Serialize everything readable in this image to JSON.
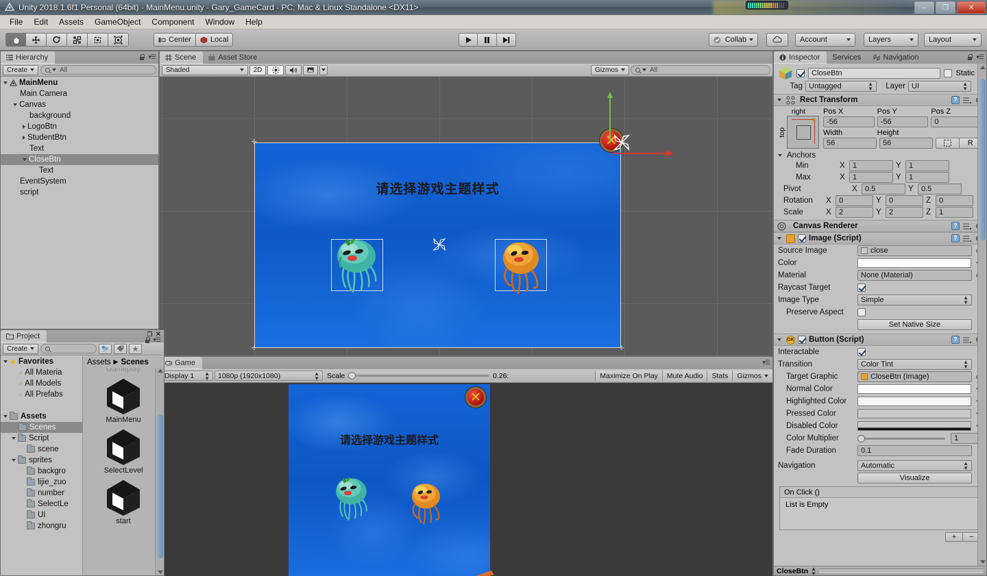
{
  "window": {
    "title": "Unity 2018.1.6f1 Personal (64bit) - MainMenu.unity - Gary_GameCard - PC, Mac & Linux Standalone <DX11>",
    "minimize": "–",
    "maximize": "❐",
    "close": "✕"
  },
  "menu": {
    "items": [
      "File",
      "Edit",
      "Assets",
      "GameObject",
      "Component",
      "Window",
      "Help"
    ]
  },
  "toolbar": {
    "transform_tools": [
      "hand-tool",
      "move-tool",
      "rotate-tool",
      "scale-tool",
      "rect-tool",
      "transform-tool"
    ],
    "pivot_mode": "Center",
    "pivot_rotation": "Local",
    "play": "▶",
    "pause": "▐▐",
    "step": "▶|",
    "collab": "Collab",
    "cloud": "cloud-icon",
    "account": "Account",
    "layers": "Layers",
    "layout": "Layout"
  },
  "hierarchy": {
    "tab": "Hierarchy",
    "create": "Create",
    "search_placeholder": "All",
    "items": [
      {
        "label": "MainMenu",
        "depth": 0,
        "arrow": "open",
        "bold": true,
        "selected": false,
        "icon": "unity"
      },
      {
        "label": "Main Camera",
        "depth": 1,
        "arrow": "none",
        "bold": false,
        "selected": false
      },
      {
        "label": "Canvas",
        "depth": 1,
        "arrow": "open",
        "bold": false,
        "selected": false
      },
      {
        "label": "background",
        "depth": 2,
        "arrow": "none",
        "bold": false,
        "selected": false
      },
      {
        "label": "LogoBtn",
        "depth": 2,
        "arrow": "closed",
        "bold": false,
        "selected": false
      },
      {
        "label": "StudentBtn",
        "depth": 2,
        "arrow": "closed",
        "bold": false,
        "selected": false
      },
      {
        "label": "Text",
        "depth": 2,
        "arrow": "none",
        "bold": false,
        "selected": false
      },
      {
        "label": "CloseBtn",
        "depth": 2,
        "arrow": "open",
        "bold": false,
        "selected": true
      },
      {
        "label": "Text",
        "depth": 3,
        "arrow": "none",
        "bold": false,
        "selected": false
      },
      {
        "label": "EventSystem",
        "depth": 1,
        "arrow": "none",
        "bold": false,
        "selected": false
      },
      {
        "label": "script",
        "depth": 1,
        "arrow": "none",
        "bold": false,
        "selected": false
      }
    ]
  },
  "scene": {
    "tabs": [
      {
        "label": "Scene",
        "active": true
      },
      {
        "label": "Asset Store",
        "active": false
      }
    ],
    "draw_mode": "Shaded",
    "two_d": "2D",
    "lighting": "light-icon",
    "audio": "audio-icon",
    "fx": "fx-icon",
    "gizmos": "Gizmos",
    "search_placeholder": "All",
    "content": {
      "heading": "请选择游戏主题样式",
      "close_glyph": "✕",
      "jellyfish": [
        {
          "name": "teal-jellyfish",
          "color": "#4fb5a6"
        },
        {
          "name": "orange-jellyfish",
          "color": "#e8962e"
        }
      ]
    }
  },
  "game": {
    "tab": "Game",
    "display": "Display 1",
    "resolution": "1080p (1920x1080)",
    "scale_label": "Scale",
    "scale_value": "0.26:",
    "maximize_on_play": "Maximize On Play",
    "mute_audio": "Mute Audio",
    "stats": "Stats",
    "gizmos": "Gizmos",
    "content": {
      "heading": "请选择游戏主题样式",
      "close_glyph": "✕"
    }
  },
  "project": {
    "tab": "Project",
    "create": "Create",
    "search_placeholder": "",
    "breadcrumb": [
      "Assets",
      "Scenes"
    ],
    "tree": [
      {
        "label": "Favorites",
        "depth": 0,
        "arrow": "open",
        "icon": "star",
        "bold": true,
        "selected": false
      },
      {
        "label": "All Materia",
        "depth": 1,
        "arrow": "none",
        "icon": "search",
        "bold": false,
        "selected": false
      },
      {
        "label": "All Models",
        "depth": 1,
        "arrow": "none",
        "icon": "search",
        "bold": false,
        "selected": false
      },
      {
        "label": "All Prefabs",
        "depth": 1,
        "arrow": "none",
        "icon": "search",
        "bold": false,
        "selected": false
      },
      {
        "label": "",
        "depth": 0,
        "arrow": "none",
        "icon": "none",
        "bold": false,
        "selected": false
      },
      {
        "label": "Assets",
        "depth": 0,
        "arrow": "open",
        "icon": "folder",
        "bold": true,
        "selected": false
      },
      {
        "label": "Scenes",
        "depth": 1,
        "arrow": "none",
        "icon": "folder",
        "bold": false,
        "selected": true
      },
      {
        "label": "Script",
        "depth": 1,
        "arrow": "open",
        "icon": "folder",
        "bold": false,
        "selected": false
      },
      {
        "label": "scene",
        "depth": 2,
        "arrow": "none",
        "icon": "folder",
        "bold": false,
        "selected": false
      },
      {
        "label": "sprites",
        "depth": 1,
        "arrow": "open",
        "icon": "folder",
        "bold": false,
        "selected": false
      },
      {
        "label": "backgro",
        "depth": 2,
        "arrow": "none",
        "icon": "folder",
        "bold": false,
        "selected": false
      },
      {
        "label": "lijie_zuo",
        "depth": 2,
        "arrow": "none",
        "icon": "folderb",
        "bold": false,
        "selected": false
      },
      {
        "label": "number",
        "depth": 2,
        "arrow": "none",
        "icon": "folder",
        "bold": false,
        "selected": false
      },
      {
        "label": "SelectLe",
        "depth": 2,
        "arrow": "none",
        "icon": "folder",
        "bold": false,
        "selected": false
      },
      {
        "label": "UI",
        "depth": 2,
        "arrow": "none",
        "icon": "folder",
        "bold": false,
        "selected": false
      },
      {
        "label": "zhongru",
        "depth": 2,
        "arrow": "none",
        "icon": "folder",
        "bold": false,
        "selected": false
      }
    ],
    "assets": [
      {
        "label": "Gameplay",
        "partial": true
      },
      {
        "label": "MainMenu",
        "partial": false
      },
      {
        "label": "SelectLevel",
        "partial": false
      },
      {
        "label": "start",
        "partial": false
      }
    ]
  },
  "inspector": {
    "tabs": [
      {
        "label": "Inspector",
        "active": true
      },
      {
        "label": "Services",
        "active": false
      },
      {
        "label": "Navigation",
        "active": false
      }
    ],
    "object_name": "CloseBtn",
    "static_label": "Static",
    "tag_label": "Tag",
    "tag_value": "Untagged",
    "layer_label": "Layer",
    "layer_value": "UI",
    "rect_transform": {
      "title": "Rect Transform",
      "anchor_preset_right": "right",
      "anchor_preset_top": "top",
      "pos_x_label": "Pos X",
      "pos_x": "-56",
      "pos_y_label": "Pos Y",
      "pos_y": "-56",
      "pos_z_label": "Pos Z",
      "pos_z": "0",
      "width_label": "Width",
      "width": "56",
      "height_label": "Height",
      "height": "56",
      "blueprint_btn": "blueprint-icon",
      "raw_btn": "R",
      "anchors_label": "Anchors",
      "min_label": "Min",
      "min_x": "1",
      "min_y": "1",
      "max_label": "Max",
      "max_x": "1",
      "max_y": "1",
      "pivot_label": "Pivot",
      "pivot_x": "0.5",
      "pivot_y": "0.5",
      "rotation_label": "Rotation",
      "rot_x": "0",
      "rot_y": "0",
      "rot_z": "0",
      "scale_label": "Scale",
      "scale_x": "2",
      "scale_y": "2",
      "scale_z": "1"
    },
    "canvas_renderer": {
      "title": "Canvas Renderer"
    },
    "image_script": {
      "title": "Image (Script)",
      "source_image_label": "Source Image",
      "source_image": "close",
      "color_label": "Color",
      "color_value": "#FFFFFF",
      "material_label": "Material",
      "material": "None (Material)",
      "raycast_label": "Raycast Target",
      "raycast_checked": true,
      "image_type_label": "Image Type",
      "image_type": "Simple",
      "preserve_aspect_label": "Preserve Aspect",
      "preserve_aspect_checked": false,
      "set_native_size": "Set Native Size"
    },
    "button_script": {
      "title": "Button (Script)",
      "interactable_label": "Interactable",
      "interactable_checked": true,
      "transition_label": "Transition",
      "transition": "Color Tint",
      "target_graphic_label": "Target Graphic",
      "target_graphic": "CloseBtn (Image)",
      "normal_color_label": "Normal Color",
      "normal_color": "#FFFFFF",
      "highlighted_color_label": "Highlighted Color",
      "highlighted_color": "#F5F5F5",
      "pressed_color_label": "Pressed Color",
      "pressed_color": "#C8C8C8",
      "disabled_color_label": "Disabled Color",
      "disabled_color": "#C8C8C8",
      "color_multiplier_label": "Color Multiplier",
      "color_multiplier": "1",
      "fade_duration_label": "Fade Duration",
      "fade_duration": "0.1",
      "navigation_label": "Navigation",
      "navigation": "Automatic",
      "visualize": "Visualize",
      "onclick_title": "On Click ()",
      "onclick_empty": "List is Empty",
      "add": "+",
      "remove": "−"
    },
    "status_object": "CloseBtn"
  }
}
